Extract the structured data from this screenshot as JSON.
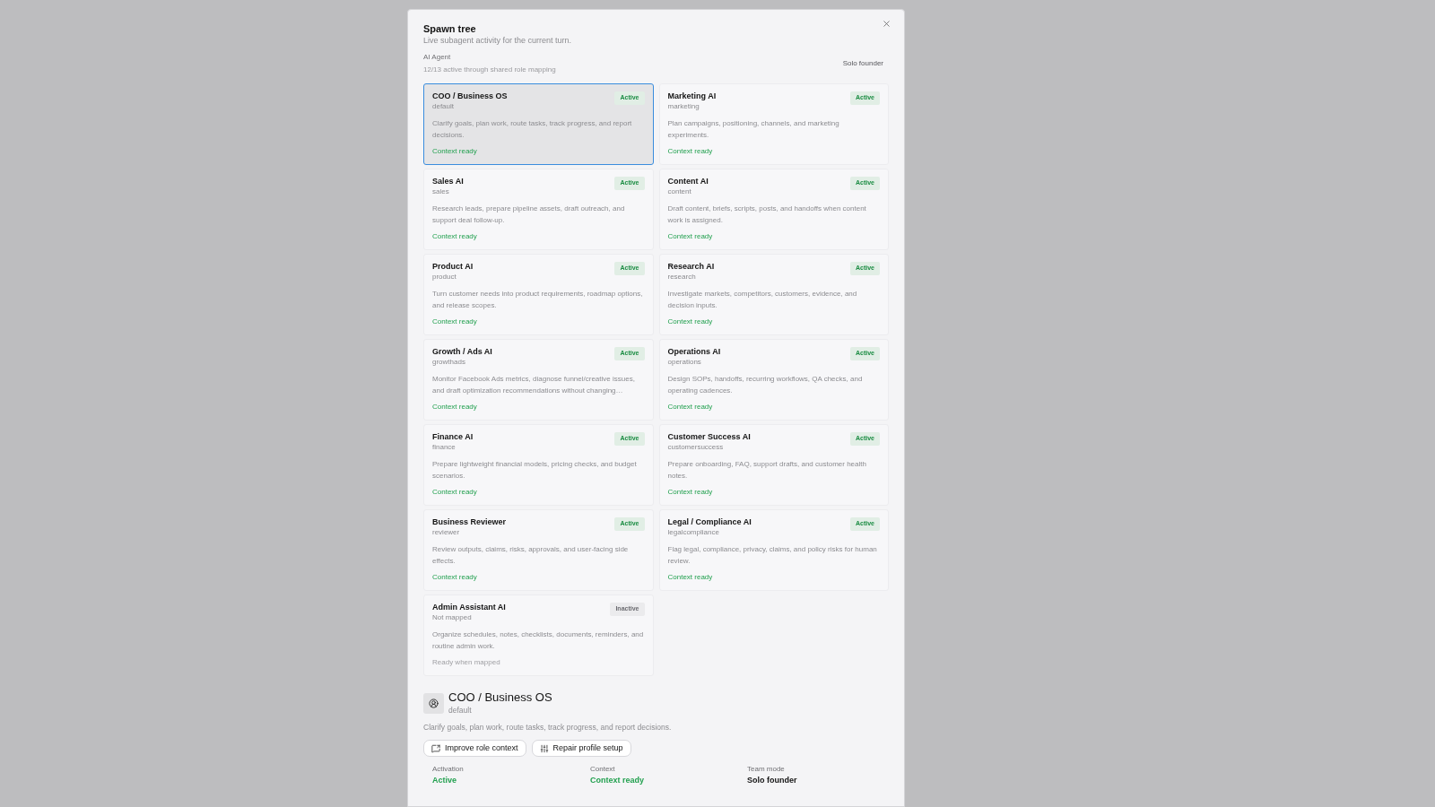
{
  "dialog": {
    "title": "Spawn tree",
    "subtitle": "Live subagent activity for the current turn.",
    "section_label": "AI Agent",
    "summary": "12/13 active through shared role mapping",
    "team_mode": "Solo founder",
    "agents": [
      {
        "name": "COO / Business OS",
        "role": "default",
        "description": "Clarify goals, plan work, route tasks, track progress, and report decisions.",
        "badge": "Active",
        "status": "Context ready",
        "active": true,
        "selected": true
      },
      {
        "name": "Marketing AI",
        "role": "marketing",
        "description": "Plan campaigns, positioning, channels, and marketing experiments.",
        "badge": "Active",
        "status": "Context ready",
        "active": true,
        "selected": false
      },
      {
        "name": "Sales AI",
        "role": "sales",
        "description": "Research leads, prepare pipeline assets, draft outreach, and support deal follow-up.",
        "badge": "Active",
        "status": "Context ready",
        "active": true,
        "selected": false
      },
      {
        "name": "Content AI",
        "role": "content",
        "description": "Draft content, briefs, scripts, posts, and handoffs when content work is assigned.",
        "badge": "Active",
        "status": "Context ready",
        "active": true,
        "selected": false
      },
      {
        "name": "Product AI",
        "role": "product",
        "description": "Turn customer needs into product requirements, roadmap options, and release scopes.",
        "badge": "Active",
        "status": "Context ready",
        "active": true,
        "selected": false
      },
      {
        "name": "Research AI",
        "role": "research",
        "description": "Investigate markets, competitors, customers, evidence, and decision inputs.",
        "badge": "Active",
        "status": "Context ready",
        "active": true,
        "selected": false
      },
      {
        "name": "Growth / Ads AI",
        "role": "growthads",
        "description": "Monitor Facebook Ads metrics, diagnose funnel/creative issues, and draft optimization recommendations without changing…",
        "badge": "Active",
        "status": "Context ready",
        "active": true,
        "selected": false
      },
      {
        "name": "Operations AI",
        "role": "operations",
        "description": "Design SOPs, handoffs, recurring workflows, QA checks, and operating cadences.",
        "badge": "Active",
        "status": "Context ready",
        "active": true,
        "selected": false
      },
      {
        "name": "Finance AI",
        "role": "finance",
        "description": "Prepare lightweight financial models, pricing checks, and budget scenarios.",
        "badge": "Active",
        "status": "Context ready",
        "active": true,
        "selected": false
      },
      {
        "name": "Customer Success AI",
        "role": "customersuccess",
        "description": "Prepare onboarding, FAQ, support drafts, and customer health notes.",
        "badge": "Active",
        "status": "Context ready",
        "active": true,
        "selected": false
      },
      {
        "name": "Business Reviewer",
        "role": "reviewer",
        "description": "Review outputs, claims, risks, approvals, and user-facing side effects.",
        "badge": "Active",
        "status": "Context ready",
        "active": true,
        "selected": false
      },
      {
        "name": "Legal / Compliance AI",
        "role": "legalcompliance",
        "description": "Flag legal, compliance, privacy, claims, and policy risks for human review.",
        "badge": "Active",
        "status": "Context ready",
        "active": true,
        "selected": false
      },
      {
        "name": "Admin Assistant AI",
        "role": "Not mapped",
        "description": "Organize schedules, notes, checklists, documents, reminders, and routine admin work.",
        "badge": "Inactive",
        "status": "Ready when mapped",
        "active": false,
        "selected": false
      }
    ],
    "detail": {
      "name": "COO / Business OS",
      "role": "default",
      "description": "Clarify goals, plan work, route tasks, track progress, and report decisions.",
      "actions": [
        {
          "label": "Improve role context",
          "kind": "improve"
        },
        {
          "label": "Repair profile setup",
          "kind": "repair"
        }
      ],
      "fields": [
        {
          "label": "Activation",
          "value": "Active",
          "kind": "positive"
        },
        {
          "label": "Context",
          "value": "Context ready",
          "kind": "positive"
        },
        {
          "label": "Team mode",
          "value": "Solo founder",
          "kind": "neutral"
        }
      ]
    }
  }
}
